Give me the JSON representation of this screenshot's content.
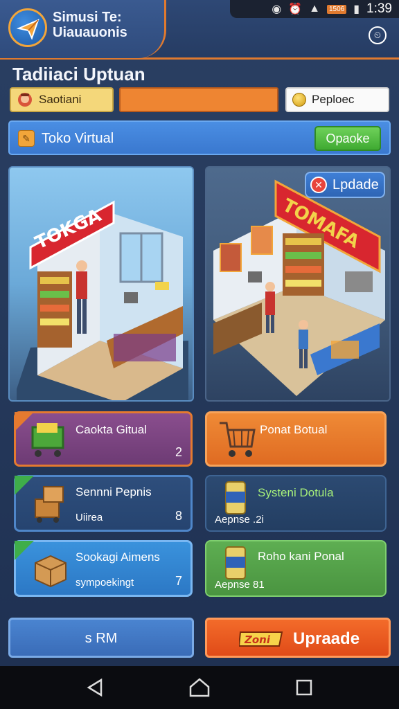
{
  "status_bar": {
    "time": "1:39",
    "battery": "1506"
  },
  "header": {
    "app_title": "Simusi Te: Uiauauonis"
  },
  "main": {
    "section_title": "Tadiiaci Uptuan",
    "player_name": "Saotiani",
    "progress_fraction": 1.0,
    "currency_label": "Peploec",
    "store_name": "Toko Virtual",
    "store_button": "Opaoke"
  },
  "scenes": {
    "left_sign": "TOKGA",
    "right_sign": "TOMAFA",
    "update_label": "Lpdade"
  },
  "cards": [
    {
      "title": "Caokta Gitual",
      "sub": "",
      "value": "2"
    },
    {
      "title": "Ponat Botual",
      "sub": "",
      "value": ""
    },
    {
      "title": "Sennni Pepnis",
      "sub": "Uiirea",
      "value": "8"
    },
    {
      "title": "Systeni Dotula",
      "sub": "Aepnse .2i",
      "value": ""
    },
    {
      "title": "Sookagi Aimens",
      "sub": "sympoekingt",
      "value": "7"
    },
    {
      "title": "Roho kani Ponal",
      "sub": "Aepnse 81",
      "value": ""
    }
  ],
  "bottom": {
    "left_label": "s  RM",
    "right_label": "Upraade",
    "right_logo": "Zoni"
  },
  "colors": {
    "accent_orange": "#e57a2f",
    "primary_blue": "#3a78cf",
    "success_green": "#3faa32"
  },
  "icons": [
    "app-logo-icon",
    "settings-icon",
    "edit-icon",
    "coin-icon",
    "close-icon",
    "cart-icon",
    "box-icon",
    "can-icon",
    "back-icon",
    "home-icon",
    "recents-icon"
  ]
}
